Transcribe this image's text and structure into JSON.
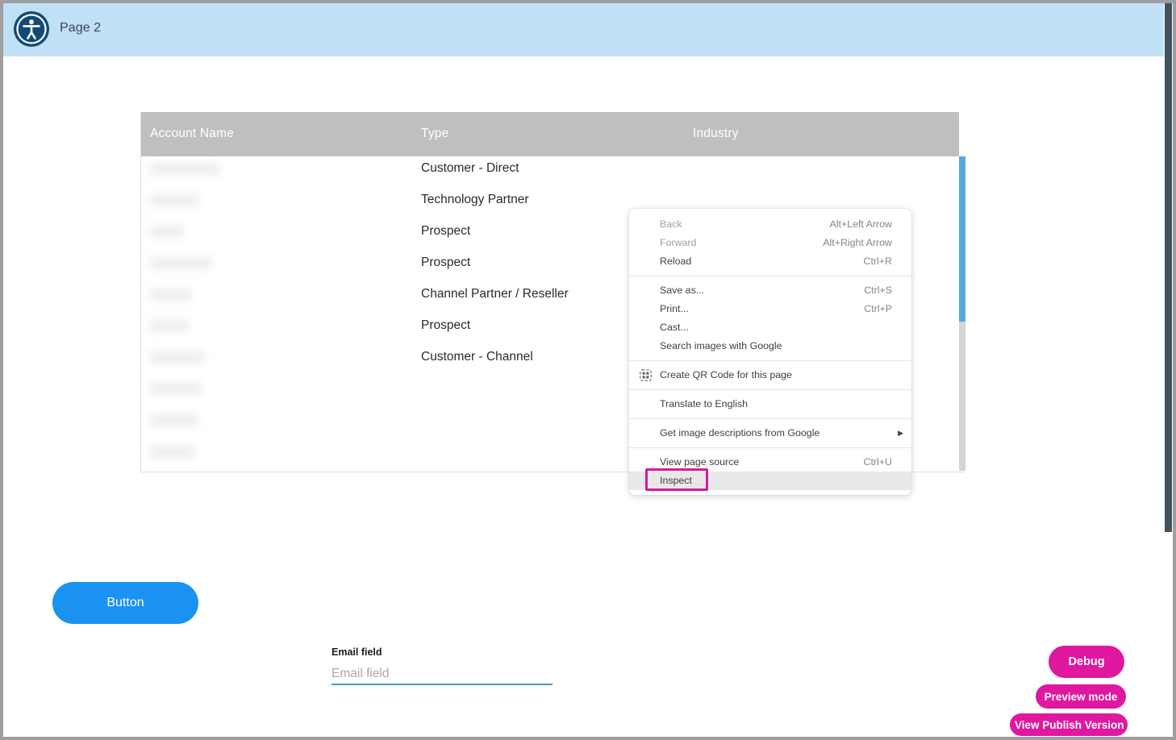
{
  "header": {
    "title": "Page 2",
    "icon": "accessibility-icon",
    "background_color": "#bfe0f5"
  },
  "table": {
    "columns": [
      "Account Name",
      "Type",
      "Industry"
    ],
    "header_background": "#bfbfbf",
    "rows": [
      {
        "account_name": "",
        "type": "Customer - Direct",
        "industry": ""
      },
      {
        "account_name": "",
        "type": "Technology Partner",
        "industry": ""
      },
      {
        "account_name": "",
        "type": "Prospect",
        "industry": ""
      },
      {
        "account_name": "",
        "type": "Prospect",
        "industry": ""
      },
      {
        "account_name": "",
        "type": "Channel Partner / Reseller",
        "industry": ""
      },
      {
        "account_name": "",
        "type": "Prospect",
        "industry": ""
      },
      {
        "account_name": "",
        "type": "Customer - Channel",
        "industry": ""
      },
      {
        "account_name": "",
        "type": "",
        "industry": ""
      },
      {
        "account_name": "",
        "type": "",
        "industry": ""
      },
      {
        "account_name": "",
        "type": "",
        "industry": ""
      }
    ],
    "scrollbar_thumb_color": "#59a7e0"
  },
  "context_menu": {
    "groups": [
      [
        {
          "label": "Back",
          "accel": "Alt+Left Arrow",
          "disabled": true,
          "icon": null,
          "submenu": false
        },
        {
          "label": "Forward",
          "accel": "Alt+Right Arrow",
          "disabled": true,
          "icon": null,
          "submenu": false
        },
        {
          "label": "Reload",
          "accel": "Ctrl+R",
          "disabled": false,
          "icon": null,
          "submenu": false
        }
      ],
      [
        {
          "label": "Save as...",
          "accel": "Ctrl+S",
          "disabled": false,
          "icon": null,
          "submenu": false
        },
        {
          "label": "Print...",
          "accel": "Ctrl+P",
          "disabled": false,
          "icon": null,
          "submenu": false
        },
        {
          "label": "Cast...",
          "accel": "",
          "disabled": false,
          "icon": null,
          "submenu": false
        },
        {
          "label": "Search images with Google",
          "accel": "",
          "disabled": false,
          "icon": null,
          "submenu": false
        }
      ],
      [
        {
          "label": "Create QR Code for this page",
          "accel": "",
          "disabled": false,
          "icon": "qr-code-icon",
          "submenu": false
        }
      ],
      [
        {
          "label": "Translate to English",
          "accel": "",
          "disabled": false,
          "icon": null,
          "submenu": false
        }
      ],
      [
        {
          "label": "Get image descriptions from Google",
          "accel": "",
          "disabled": false,
          "icon": null,
          "submenu": true
        }
      ],
      [
        {
          "label": "View page source",
          "accel": "Ctrl+U",
          "disabled": false,
          "icon": null,
          "submenu": false
        },
        {
          "label": "Inspect",
          "accel": "",
          "disabled": false,
          "icon": null,
          "submenu": false,
          "hovered": true,
          "highlighted": true
        }
      ]
    ],
    "highlight_color": "#d6199c"
  },
  "form": {
    "button_label": "Button",
    "button_color": "#1a93f0",
    "email_label": "Email field",
    "email_placeholder": "Email field",
    "email_value": ""
  },
  "actions": {
    "debug_label": "Debug",
    "preview_label": "Preview mode",
    "publish_label": "View Publish Version",
    "pill_color": "#e0179f"
  }
}
